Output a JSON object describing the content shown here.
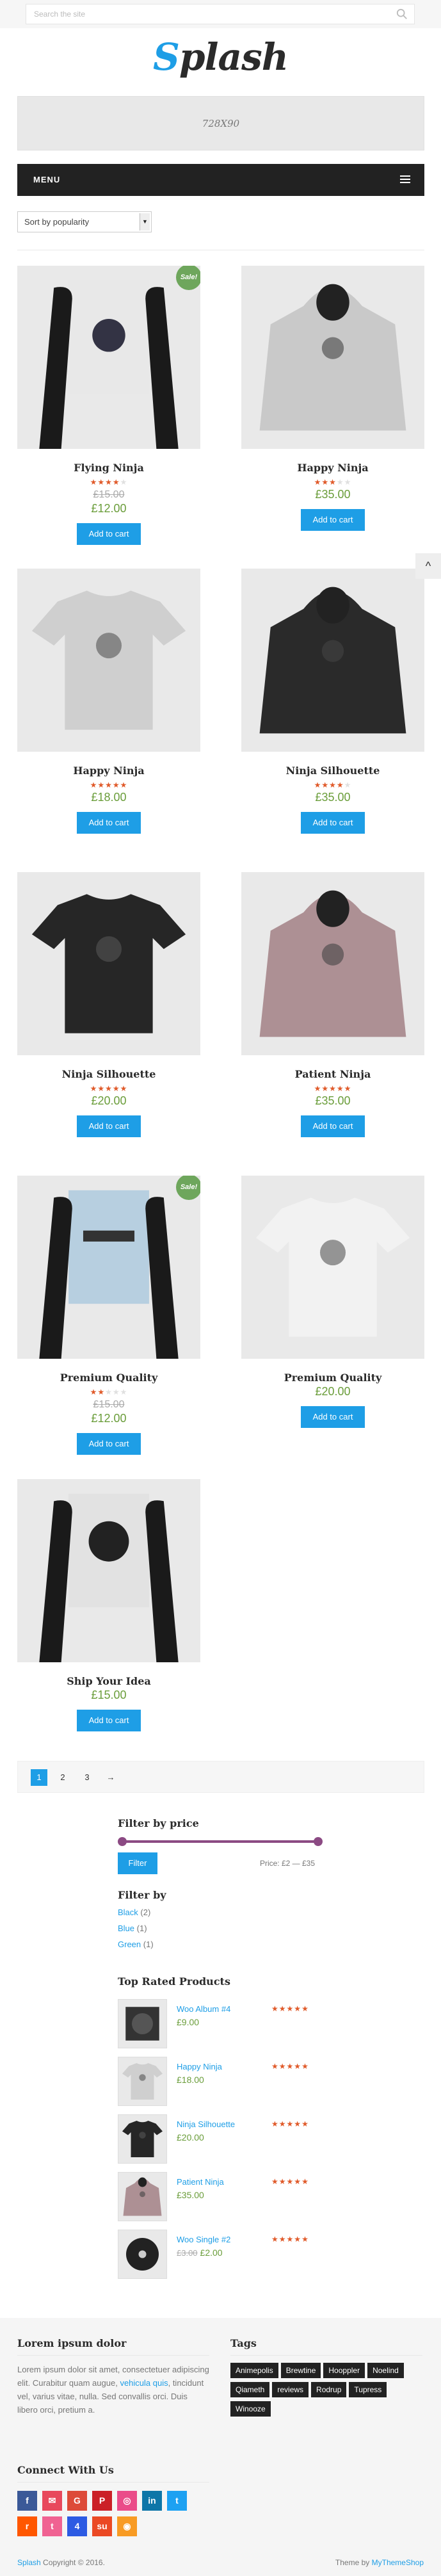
{
  "search": {
    "placeholder": "Search the site"
  },
  "logo": {
    "first": "S",
    "rest": "plash"
  },
  "ad": {
    "label": "728X90"
  },
  "menu": {
    "label": "MENU"
  },
  "sort": {
    "selected": "Sort by popularity",
    "arrow": "▼"
  },
  "sale_label": "Sale!",
  "add_to_cart": "Add to cart",
  "products": [
    {
      "name": "Flying Ninja",
      "rating": 4,
      "old_price": "£15.00",
      "price": "£12.00",
      "sale": true,
      "kind": "poster-ninja"
    },
    {
      "name": "Happy Ninja",
      "rating": 3,
      "old_price": "",
      "price": "£35.00",
      "sale": false,
      "kind": "hoodie-grey"
    },
    {
      "name": "Happy Ninja",
      "rating": 5,
      "old_price": "",
      "price": "£18.00",
      "sale": false,
      "kind": "tshirt-grey"
    },
    {
      "name": "Ninja Silhouette",
      "rating": 4,
      "old_price": "",
      "price": "£35.00",
      "sale": false,
      "kind": "hoodie-black"
    },
    {
      "name": "Ninja Silhouette",
      "rating": 5,
      "old_price": "",
      "price": "£20.00",
      "sale": false,
      "kind": "tshirt-black"
    },
    {
      "name": "Patient Ninja",
      "rating": 4.5,
      "old_price": "",
      "price": "£35.00",
      "sale": false,
      "kind": "hoodie-pink"
    },
    {
      "name": "Premium Quality",
      "rating": 2,
      "old_price": "£15.00",
      "price": "£12.00",
      "sale": true,
      "kind": "poster-blue"
    },
    {
      "name": "Premium Quality",
      "rating": 0,
      "old_price": "",
      "price": "£20.00",
      "sale": false,
      "kind": "tshirt-white"
    },
    {
      "name": "Ship Your Idea",
      "rating": 0,
      "old_price": "",
      "price": "£15.00",
      "sale": false,
      "kind": "poster-skull"
    }
  ],
  "pagination": {
    "pages": [
      "1",
      "2",
      "3"
    ],
    "next": "→"
  },
  "filter_price": {
    "title": "Filter by price",
    "button": "Filter",
    "range": "Price: £2 — £35"
  },
  "filter_by": {
    "title": "Filter by",
    "items": [
      {
        "label": "Black",
        "count": "(2)"
      },
      {
        "label": "Blue",
        "count": "(1)"
      },
      {
        "label": "Green",
        "count": "(1)"
      }
    ]
  },
  "top_rated": {
    "title": "Top Rated Products",
    "items": [
      {
        "name": "Woo Album #4",
        "price": "£9.00",
        "old_price": "",
        "rating": 5,
        "kind": "album"
      },
      {
        "name": "Happy Ninja",
        "price": "£18.00",
        "old_price": "",
        "rating": 5,
        "kind": "tshirt-grey"
      },
      {
        "name": "Ninja Silhouette",
        "price": "£20.00",
        "old_price": "",
        "rating": 5,
        "kind": "tshirt-black"
      },
      {
        "name": "Patient Ninja",
        "price": "£35.00",
        "old_price": "",
        "rating": 5,
        "kind": "hoodie-pink"
      },
      {
        "name": "Woo Single #2",
        "price": "£2.00",
        "old_price": "£3.00",
        "rating": 4.5,
        "kind": "single"
      }
    ]
  },
  "footer": {
    "lorem_title": "Lorem ipsum dolor",
    "lorem_text_1": "Lorem ipsum dolor sit amet, consectetuer adipiscing elit. Curabitur quam augue, ",
    "lorem_link": "vehicula quis",
    "lorem_text_2": ", tincidunt vel, varius vitae, nulla. Sed convallis orci. Duis libero orci, pretium a.",
    "tags_title": "Tags",
    "tags": [
      "Animepolis",
      "Brewtine",
      "Hooppler",
      "Noelind",
      "Qiameth",
      "reviews",
      "Rodrup",
      "Tupress",
      "Winooze"
    ],
    "connect_title": "Connect With Us",
    "social": [
      {
        "icon": "facebook-icon",
        "glyph": "f",
        "color": "#3b5998"
      },
      {
        "icon": "email-icon",
        "glyph": "✉",
        "color": "#e8485c"
      },
      {
        "icon": "google-plus-icon",
        "glyph": "G",
        "color": "#dd4b39"
      },
      {
        "icon": "pinterest-icon",
        "glyph": "P",
        "color": "#cb2027"
      },
      {
        "icon": "dribbble-icon",
        "glyph": "◎",
        "color": "#ea4c89"
      },
      {
        "icon": "linkedin-icon",
        "glyph": "in",
        "color": "#0e76a8"
      },
      {
        "icon": "twitter-icon",
        "glyph": "t",
        "color": "#1da1f2"
      },
      {
        "icon": "reddit-icon",
        "glyph": "r",
        "color": "#ff5700"
      },
      {
        "icon": "tumblr-icon",
        "glyph": "t",
        "color": "#f06292"
      },
      {
        "icon": "foursquare-icon",
        "glyph": "4",
        "color": "#2d5be3"
      },
      {
        "icon": "stumbleupon-icon",
        "glyph": "su",
        "color": "#eb4924"
      },
      {
        "icon": "rss-icon",
        "glyph": "◉",
        "color": "#f89b24"
      }
    ],
    "copyright_link": "Splash",
    "copyright_text": " Copyright © 2016.",
    "theme_text": "Theme by ",
    "theme_link": "MyThemeShop"
  },
  "colors": {
    "accent": "#1e9ee6",
    "price": "#6a9d3a",
    "sale": "#6ea65c",
    "stars": "#e05a2a",
    "slider": "#8b4a83"
  }
}
